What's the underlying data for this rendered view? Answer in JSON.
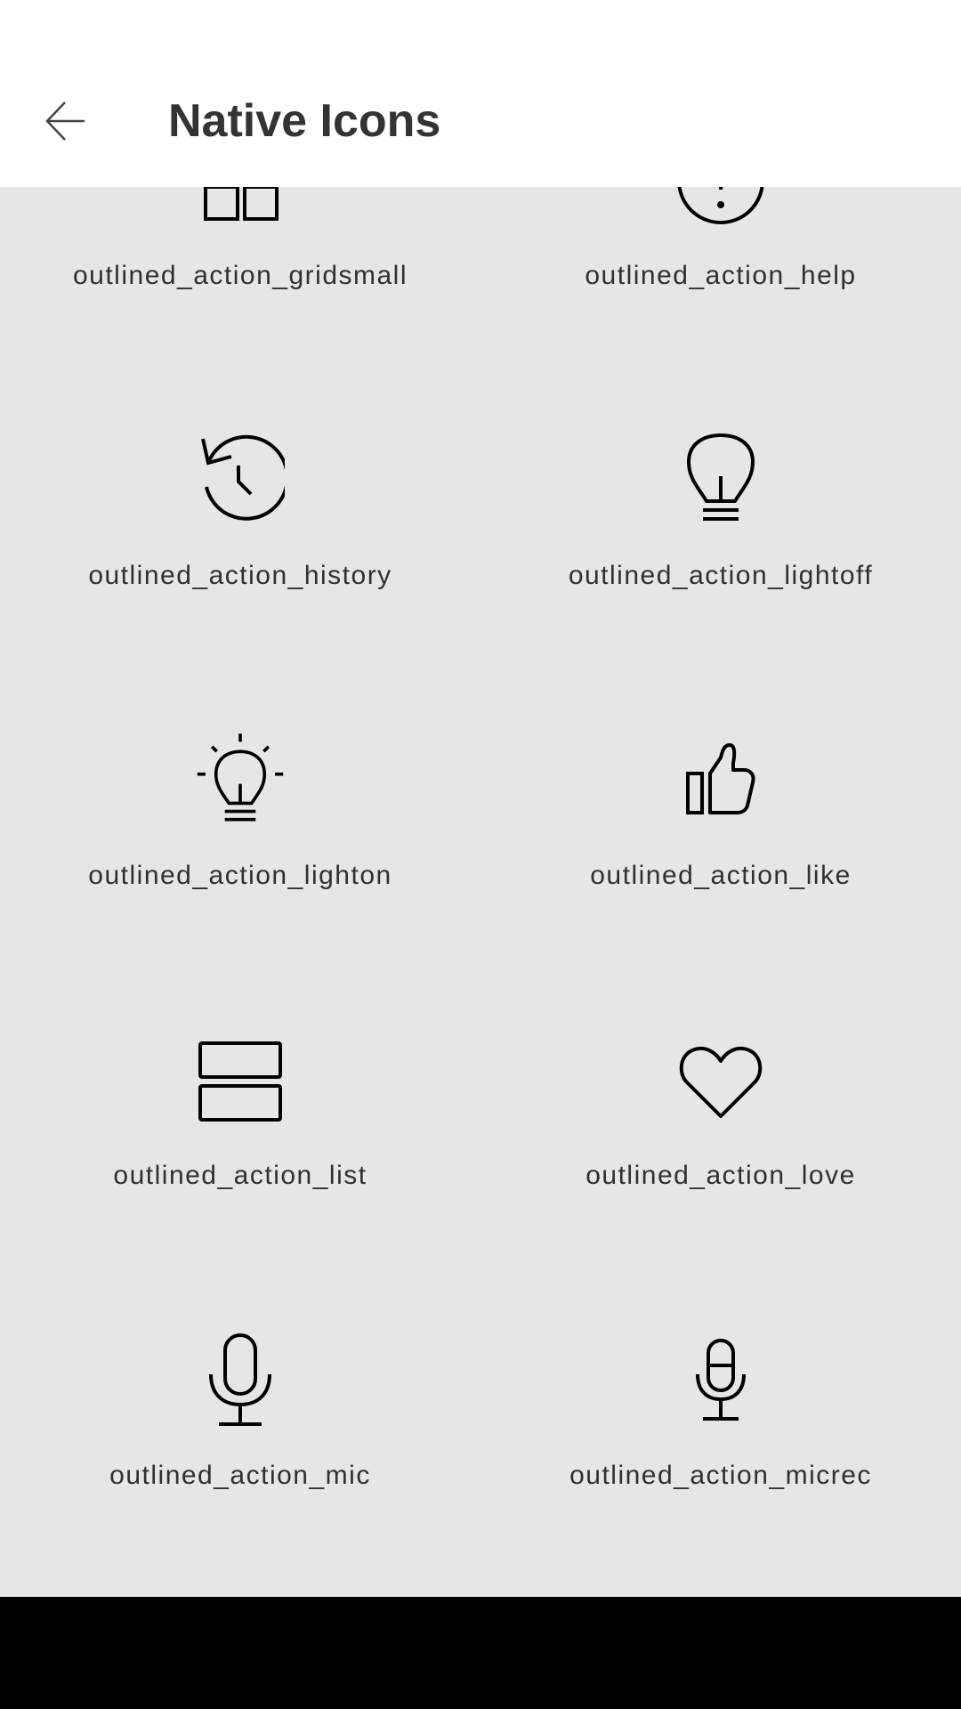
{
  "app_bar": {
    "title": "Native Icons",
    "back_icon": "arrow-left-icon"
  },
  "icons": [
    {
      "label": "outlined_action_gridsmall",
      "icon": "grid-icon"
    },
    {
      "label": "outlined_action_help",
      "icon": "help-icon"
    },
    {
      "label": "outlined_action_history",
      "icon": "history-icon"
    },
    {
      "label": "outlined_action_lightoff",
      "icon": "lightbulb-off-icon"
    },
    {
      "label": "outlined_action_lighton",
      "icon": "lightbulb-on-icon"
    },
    {
      "label": "outlined_action_like",
      "icon": "thumbs-up-icon"
    },
    {
      "label": "outlined_action_list",
      "icon": "list-icon"
    },
    {
      "label": "outlined_action_love",
      "icon": "heart-icon"
    },
    {
      "label": "outlined_action_mic",
      "icon": "mic-icon"
    },
    {
      "label": "outlined_action_micrec",
      "icon": "mic-record-icon"
    }
  ],
  "colors": {
    "background": "#e6e6e6",
    "app_bar": "#ffffff",
    "title_text": "#333333",
    "label_text": "#303030",
    "icon_stroke": "#000000",
    "nav_bar": "#000000"
  }
}
